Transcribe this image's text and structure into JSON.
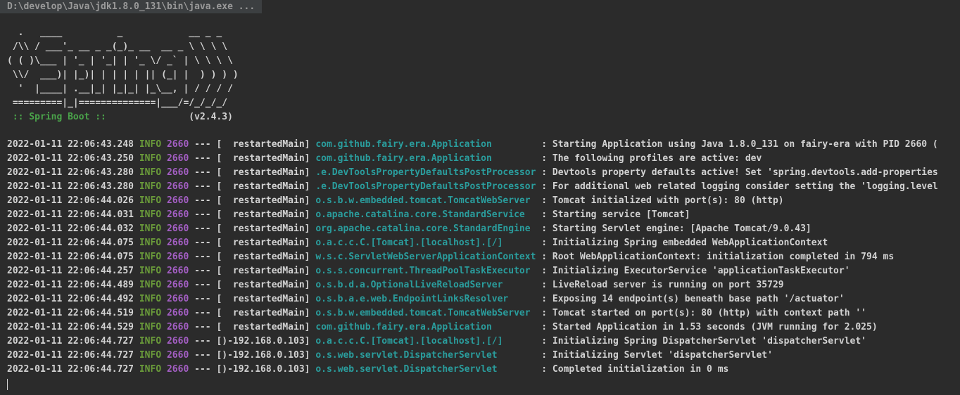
{
  "console": {
    "command": "D:\\develop\\Java\\jdk1.8.0_131\\bin\\java.exe ...",
    "banner": [
      "  .   ____          _            __ _ _",
      " /\\\\ / ___'_ __ _ _(_)_ __  __ _ \\ \\ \\ \\",
      "( ( )\\___ | '_ | '_| | '_ \\/ _` | \\ \\ \\ \\",
      " \\\\/  ___)| |_)| | | | | || (_| |  ) ) ) )",
      "  '  |____| .__|_| |_|_| |_\\__, | / / / /",
      " =========|_|==============|___/=/_/_/_/"
    ],
    "spring_label": " :: Spring Boot :: ",
    "spring_version": "              (v2.4.3)",
    "colors": {
      "background": "#2b2b2b",
      "info": "#6a9b3a",
      "pid": "#a45fc4",
      "logger": "#2a9d9d",
      "text": "#d2d2d2"
    },
    "logs": [
      {
        "date": "2022-01-11 22:06:43.248",
        "level": "INFO",
        "pid": "2660",
        "sep": "---",
        "thread": "[  restartedMain]",
        "logger": "com.github.fairy.era.Application        ",
        "message": ": Starting Application using Java 1.8.0_131 on fairy-era with PID 2660 ("
      },
      {
        "date": "2022-01-11 22:06:43.250",
        "level": "INFO",
        "pid": "2660",
        "sep": "---",
        "thread": "[  restartedMain]",
        "logger": "com.github.fairy.era.Application        ",
        "message": ": The following profiles are active: dev"
      },
      {
        "date": "2022-01-11 22:06:43.280",
        "level": "INFO",
        "pid": "2660",
        "sep": "---",
        "thread": "[  restartedMain]",
        "logger": ".e.DevToolsPropertyDefaultsPostProcessor",
        "message": ": Devtools property defaults active! Set 'spring.devtools.add-properties"
      },
      {
        "date": "2022-01-11 22:06:43.280",
        "level": "INFO",
        "pid": "2660",
        "sep": "---",
        "thread": "[  restartedMain]",
        "logger": ".e.DevToolsPropertyDefaultsPostProcessor",
        "message": ": For additional web related logging consider setting the 'logging.level"
      },
      {
        "date": "2022-01-11 22:06:44.026",
        "level": "INFO",
        "pid": "2660",
        "sep": "---",
        "thread": "[  restartedMain]",
        "logger": "o.s.b.w.embedded.tomcat.TomcatWebServer ",
        "message": ": Tomcat initialized with port(s): 80 (http)"
      },
      {
        "date": "2022-01-11 22:06:44.031",
        "level": "INFO",
        "pid": "2660",
        "sep": "---",
        "thread": "[  restartedMain]",
        "logger": "o.apache.catalina.core.StandardService  ",
        "message": ": Starting service [Tomcat]"
      },
      {
        "date": "2022-01-11 22:06:44.032",
        "level": "INFO",
        "pid": "2660",
        "sep": "---",
        "thread": "[  restartedMain]",
        "logger": "org.apache.catalina.core.StandardEngine ",
        "message": ": Starting Servlet engine: [Apache Tomcat/9.0.43]"
      },
      {
        "date": "2022-01-11 22:06:44.075",
        "level": "INFO",
        "pid": "2660",
        "sep": "---",
        "thread": "[  restartedMain]",
        "logger": "o.a.c.c.C.[Tomcat].[localhost].[/]      ",
        "message": ": Initializing Spring embedded WebApplicationContext"
      },
      {
        "date": "2022-01-11 22:06:44.075",
        "level": "INFO",
        "pid": "2660",
        "sep": "---",
        "thread": "[  restartedMain]",
        "logger": "w.s.c.ServletWebServerApplicationContext",
        "message": ": Root WebApplicationContext: initialization completed in 794 ms"
      },
      {
        "date": "2022-01-11 22:06:44.257",
        "level": "INFO",
        "pid": "2660",
        "sep": "---",
        "thread": "[  restartedMain]",
        "logger": "o.s.s.concurrent.ThreadPoolTaskExecutor ",
        "message": ": Initializing ExecutorService 'applicationTaskExecutor'"
      },
      {
        "date": "2022-01-11 22:06:44.489",
        "level": "INFO",
        "pid": "2660",
        "sep": "---",
        "thread": "[  restartedMain]",
        "logger": "o.s.b.d.a.OptionalLiveReloadServer      ",
        "message": ": LiveReload server is running on port 35729"
      },
      {
        "date": "2022-01-11 22:06:44.492",
        "level": "INFO",
        "pid": "2660",
        "sep": "---",
        "thread": "[  restartedMain]",
        "logger": "o.s.b.a.e.web.EndpointLinksResolver     ",
        "message": ": Exposing 14 endpoint(s) beneath base path '/actuator'"
      },
      {
        "date": "2022-01-11 22:06:44.519",
        "level": "INFO",
        "pid": "2660",
        "sep": "---",
        "thread": "[  restartedMain]",
        "logger": "o.s.b.w.embedded.tomcat.TomcatWebServer ",
        "message": ": Tomcat started on port(s): 80 (http) with context path ''"
      },
      {
        "date": "2022-01-11 22:06:44.529",
        "level": "INFO",
        "pid": "2660",
        "sep": "---",
        "thread": "[  restartedMain]",
        "logger": "com.github.fairy.era.Application        ",
        "message": ": Started Application in 1.53 seconds (JVM running for 2.025)"
      },
      {
        "date": "2022-01-11 22:06:44.727",
        "level": "INFO",
        "pid": "2660",
        "sep": "---",
        "thread": "[)-192.168.0.103]",
        "logger": "o.a.c.c.C.[Tomcat].[localhost].[/]      ",
        "message": ": Initializing Spring DispatcherServlet 'dispatcherServlet'"
      },
      {
        "date": "2022-01-11 22:06:44.727",
        "level": "INFO",
        "pid": "2660",
        "sep": "---",
        "thread": "[)-192.168.0.103]",
        "logger": "o.s.web.servlet.DispatcherServlet       ",
        "message": ": Initializing Servlet 'dispatcherServlet'"
      },
      {
        "date": "2022-01-11 22:06:44.727",
        "level": "INFO",
        "pid": "2660",
        "sep": "---",
        "thread": "[)-192.168.0.103]",
        "logger": "o.s.web.servlet.DispatcherServlet       ",
        "message": ": Completed initialization in 0 ms"
      }
    ]
  }
}
